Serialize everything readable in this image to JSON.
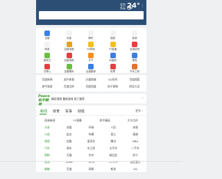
{
  "header": {
    "city": [
      "北京",
      "多云"
    ],
    "temperature": "24°",
    "more": "⋮",
    "accent": "#2c4e75"
  },
  "apps": [
    {
      "label": "百度",
      "color": "#3d7fe0",
      "icon": "baidu-icon"
    },
    {
      "label": "凤凰",
      "color": "#f3f3f3",
      "icon": "phoenix-icon"
    },
    {
      "label": "腾讯",
      "color": "#f3f3f3",
      "icon": "tencent-icon"
    },
    {
      "label": "搜狐",
      "color": "#f3f3f3",
      "icon": "sohu-icon"
    },
    {
      "label": "新浪",
      "color": "#f3f3f3",
      "icon": "sina-icon"
    },
    {
      "label": "网易",
      "color": "#f3f3f3",
      "icon": "netease-icon"
    },
    {
      "label": "百度地图",
      "color": "#e8a020",
      "icon": "map-icon"
    },
    {
      "label": "58同城",
      "color": "#f3c020",
      "icon": "tongcheng-icon"
    },
    {
      "label": "YY直播",
      "color": "#f3c020",
      "icon": "yy-icon"
    },
    {
      "label": "百度贴吧",
      "color": "#e84040",
      "icon": "tieba-icon"
    },
    {
      "label": "爱奇艺",
      "color": "#6abf40",
      "icon": "iqiyi-icon"
    },
    {
      "label": "百度视频",
      "color": "#e04040",
      "icon": "video-icon"
    },
    {
      "label": "天气",
      "color": "#f39020",
      "icon": "weather-icon"
    },
    {
      "label": "凤凰网",
      "color": "#3d7fe0",
      "icon": "ifeng-icon"
    },
    {
      "label": "携程",
      "color": "#3d7fe0",
      "icon": "ctrip-icon"
    },
    {
      "label": "去哪儿",
      "color": "#e04040",
      "icon": "qunar-icon"
    },
    {
      "label": "百度糯米",
      "color": "#6abf40",
      "icon": "nuomi-icon"
    },
    {
      "label": "百度翻译",
      "color": "#3d7fe0",
      "icon": "translate-icon"
    },
    {
      "label": "彩票",
      "color": "#e04040",
      "icon": "lottery-icon"
    },
    {
      "label": "汽车之家",
      "color": "#e87030",
      "icon": "autohome-icon"
    },
    {
      "label": "美团",
      "color": "#e04040",
      "icon": "meituan-icon"
    },
    {
      "label": "知乎",
      "color": "#2c7be0",
      "icon": "zhihu-icon"
    },
    {
      "label": "中华网",
      "color": "#3d7fe0",
      "icon": "china-icon"
    },
    {
      "label": "12306",
      "color": "#3d7fe0",
      "icon": "railway-icon"
    }
  ],
  "links": [
    [
      "百度新闻",
      "虎扑体育",
      "天猫商城",
      "QQ空间",
      "百度搜索"
    ],
    [
      "途牛旅游",
      "百度文库",
      "百度知道",
      "苏宁易购",
      "网址大全"
    ]
  ],
  "banner": {
    "logo": [
      "Peace",
      "和平精英"
    ],
    "text": "精彩视频 最新游戏 热门推荐",
    "arrow": "›"
  },
  "news": {
    "tabs": [
      "新闻",
      "体育",
      "军事",
      "财经"
    ],
    "more": "更多 ›",
    "rows": [
      [
        "网易新闻",
        "YY直播",
        "和平精英",
        "大众点评"
      ],
      [
        "头条",
        "凤凰",
        "环球",
        "人民",
        "央视"
      ],
      [
        "小说",
        "起点",
        "纵横",
        "晋江",
        "潇湘"
      ],
      [
        "视频",
        "优酷",
        "爱奇艺",
        "腾讯",
        "NBA"
      ],
      [
        "汽车",
        "易车",
        "车之家",
        "太平洋",
        "二手车"
      ],
      [
        "购物",
        "天猫",
        "京东",
        "唯品会",
        "苏宁"
      ],
      [
        "游戏",
        "4399",
        "7k7k",
        "17173",
        "游民星空"
      ],
      [
        "邮箱",
        "百度",
        "网易",
        "新浪",
        "QQ"
      ]
    ]
  }
}
